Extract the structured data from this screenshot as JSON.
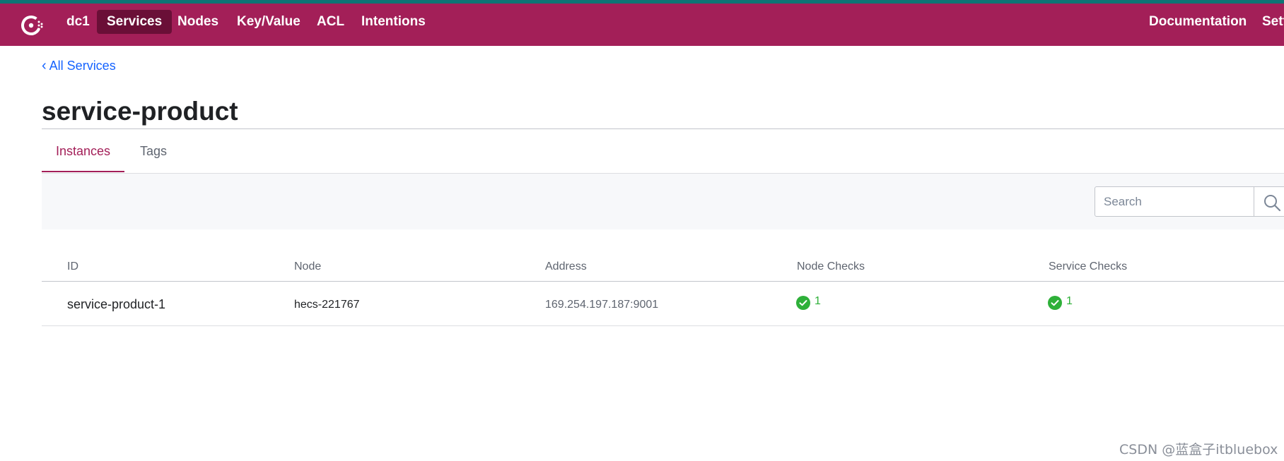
{
  "header": {
    "datacenter": "dc1",
    "nav": [
      {
        "label": "Services",
        "active": true
      },
      {
        "label": "Nodes"
      },
      {
        "label": "Key/Value"
      },
      {
        "label": "ACL"
      },
      {
        "label": "Intentions"
      }
    ],
    "right_nav": [
      {
        "label": "Documentation"
      },
      {
        "label": "Settings"
      }
    ],
    "logo_icon": "consul-logo-icon",
    "bar_color": "#a31f58",
    "active_color": "#6a0f37"
  },
  "breadcrumb": {
    "label": "All Services"
  },
  "page": {
    "title": "service-product"
  },
  "tabs": [
    {
      "label": "Instances",
      "active": true
    },
    {
      "label": "Tags"
    }
  ],
  "search": {
    "placeholder": "Search",
    "value": "",
    "icon": "search-icon"
  },
  "table": {
    "columns": [
      "ID",
      "Node",
      "Address",
      "Node Checks",
      "Service Checks"
    ],
    "rows": [
      {
        "id": "service-product-1",
        "node": "hecs-221767",
        "address": "169.254.197.187:9001",
        "node_checks": "1",
        "service_checks": "1"
      }
    ],
    "check_icon": "check-circle-icon",
    "passing_color": "#2eb039"
  },
  "watermark": "CSDN @蓝盒子itbluebox"
}
